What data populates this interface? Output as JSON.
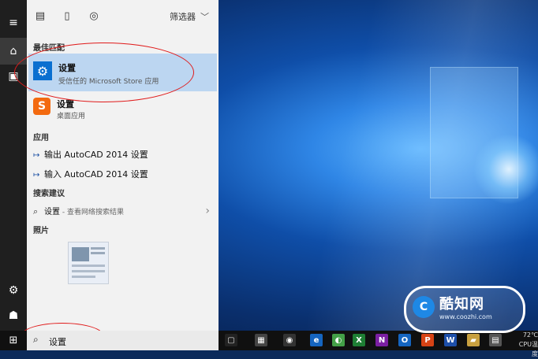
{
  "start_menu": {
    "filter_label": "筛选器",
    "sections": {
      "best_match": "最佳匹配",
      "apps": "应用",
      "search_suggestions": "搜索建议",
      "photos": "照片"
    },
    "best_match_item": {
      "title": "设置",
      "subtitle": "受信任的 Microsoft Store 应用",
      "icon": "gear-icon"
    },
    "second_item": {
      "title": "设置",
      "subtitle": "桌面应用",
      "icon": "sogou-s-icon"
    },
    "apps": [
      {
        "label": "输出 AutoCAD 2014 设置"
      },
      {
        "label": "输入 AutoCAD 2014 设置"
      }
    ],
    "suggestion": {
      "label": "设置",
      "hint": " - 查看网络搜索结果"
    }
  },
  "taskbar": {
    "search_query": "设置",
    "tray_temp": "72℃",
    "tray_label": "CPU温度"
  },
  "watermark": {
    "title": "酷知网",
    "url": "www.coozhi.com"
  },
  "colors": {
    "selected_row": "#bcd6f1",
    "accent_blue": "#0a6fd0",
    "annotation_red": "#e01a1a"
  }
}
